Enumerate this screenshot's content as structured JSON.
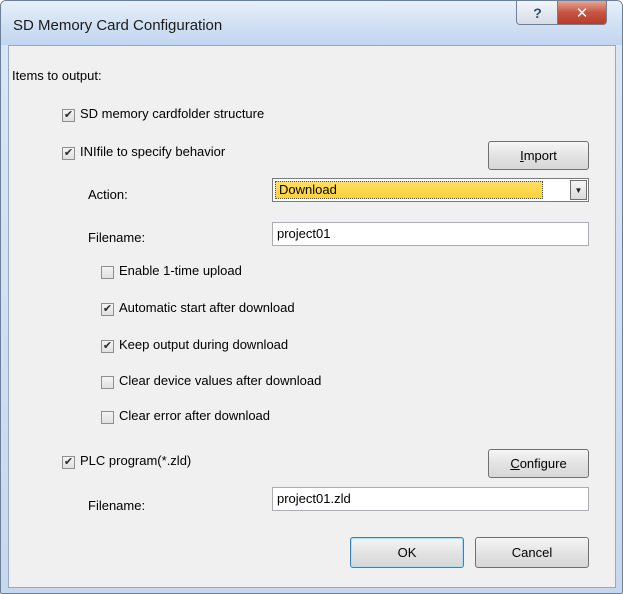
{
  "window": {
    "title": "SD Memory Card Configuration",
    "help_glyph": "?",
    "close_glyph": "✕"
  },
  "section_label": "Items to output:",
  "checkboxes": {
    "folder_structure": {
      "label": "SD memory cardfolder structure",
      "checked": true
    },
    "ini_file": {
      "label": "INIfile to specify behavior",
      "checked": true
    },
    "enable_upload": {
      "label": "Enable 1-time upload",
      "checked": false
    },
    "auto_start": {
      "label": "Automatic start after download",
      "checked": true
    },
    "keep_output": {
      "label": "Keep output during download",
      "checked": true
    },
    "clear_device": {
      "label": "Clear device values after download",
      "checked": false
    },
    "clear_error": {
      "label": "Clear error after download",
      "checked": false
    },
    "plc_program": {
      "label": "PLC program(*.zld)",
      "checked": true
    }
  },
  "ini": {
    "action_label": "Action:",
    "action_value": "Download",
    "filename_label": "Filename:",
    "filename_value": "project01",
    "import_label_u": "I",
    "import_label_rest": "mport"
  },
  "plc": {
    "filename_label": "Filename:",
    "filename_value": "project01.zld",
    "configure_label_u": "C",
    "configure_label_rest": "onfigure"
  },
  "footer": {
    "ok_label": "OK",
    "cancel_label": "Cancel"
  },
  "icons": {
    "checkmark": "✔",
    "dropdown": "▼"
  }
}
